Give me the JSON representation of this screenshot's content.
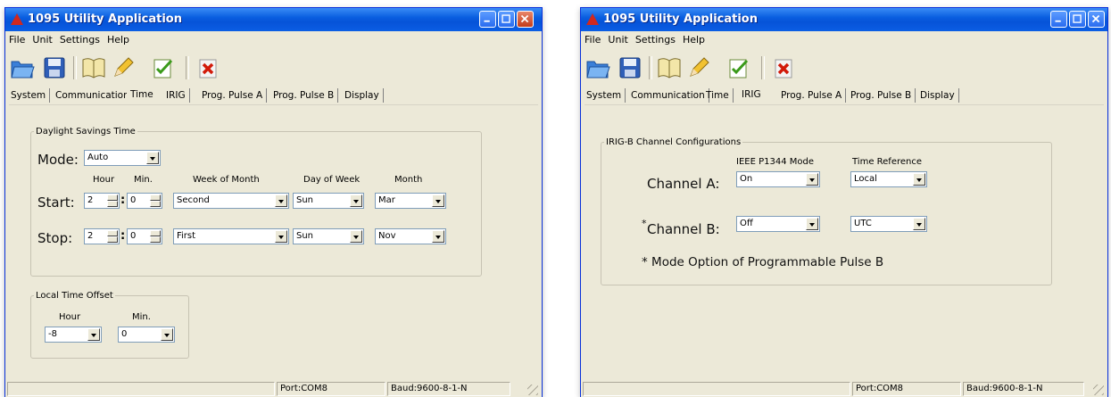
{
  "left": {
    "title": "1095 Utility Application",
    "menu": [
      "File",
      "Unit",
      "Settings",
      "Help"
    ],
    "tabs": [
      "System",
      "Communication",
      "Time",
      "IRIG",
      "Prog. Pulse A",
      "Prog. Pulse B",
      "Display"
    ],
    "active_tab": "Time",
    "dst": {
      "legend": "Daylight Savings Time",
      "mode_label": "Mode:",
      "mode_value": "Auto",
      "col_hour": "Hour",
      "col_min": "Min.",
      "col_week": "Week of Month",
      "col_day": "Day of Week",
      "col_month": "Month",
      "start_label": "Start:",
      "start": {
        "hour": "2",
        "min": "0",
        "week": "Second",
        "day": "Sun",
        "month": "Mar"
      },
      "stop_label": "Stop:",
      "stop": {
        "hour": "2",
        "min": "0",
        "week": "First",
        "day": "Sun",
        "month": "Nov"
      }
    },
    "offset": {
      "legend": "Local Time Offset",
      "hour_label": "Hour",
      "min_label": "Min.",
      "hour_value": "-8",
      "min_value": "0"
    },
    "status": {
      "port": "Port:COM8",
      "baud": "Baud:9600-8-1-N"
    }
  },
  "right": {
    "title": "1095 Utility Application",
    "menu": [
      "File",
      "Unit",
      "Settings",
      "Help"
    ],
    "tabs": [
      "System",
      "Communication",
      "Time",
      "IRIG",
      "Prog. Pulse A",
      "Prog. Pulse B",
      "Display"
    ],
    "active_tab": "IRIG",
    "irig": {
      "legend": "IRIG-B Channel Configurations",
      "col_mode": "IEEE P1344 Mode",
      "col_ref": "Time Reference",
      "chA_label": "Channel A:",
      "chA_mode": "On",
      "chA_ref": "Local",
      "chB_star": "*",
      "chB_label": "Channel B:",
      "chB_mode": "Off",
      "chB_ref": "UTC",
      "note": "* Mode Option of Programmable Pulse B"
    },
    "status": {
      "port": "Port:COM8",
      "baud": "Baud:9600-8-1-N"
    }
  },
  "icons": [
    "open-folder-icon",
    "save-disk-icon",
    "book-icon",
    "pencil-icon",
    "checklist-icon",
    "delete-x-icon"
  ],
  "colors": {
    "titlebar": "#0a5fe0",
    "window_bg": "#ece9d8",
    "close_button": "#c43c1a"
  }
}
